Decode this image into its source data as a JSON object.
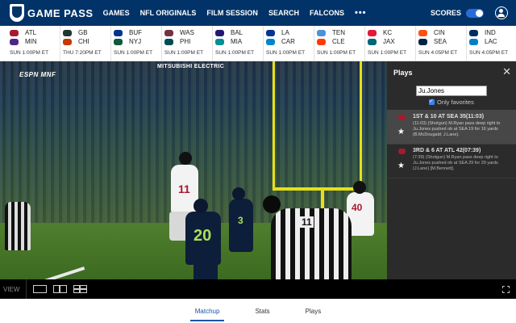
{
  "brand": "GAME PASS",
  "nav": [
    "GAMES",
    "NFL ORIGINALS",
    "FILM SESSION",
    "SEARCH",
    "FALCONS"
  ],
  "nav_more": "•••",
  "scores_label": "SCORES",
  "games": [
    {
      "away": "ATL",
      "home": "MIN",
      "away_color": "#a71930",
      "home_color": "#4f2683",
      "time": "SUN 1:00PM ET"
    },
    {
      "away": "GB",
      "home": "CHI",
      "away_color": "#203731",
      "home_color": "#c83803",
      "time": "THU 7:20PM ET"
    },
    {
      "away": "BUF",
      "home": "NYJ",
      "away_color": "#00338d",
      "home_color": "#125740",
      "time": "SUN 1:00PM ET"
    },
    {
      "away": "WAS",
      "home": "PHI",
      "away_color": "#773141",
      "home_color": "#004c54",
      "time": "SUN 1:00PM ET"
    },
    {
      "away": "BAL",
      "home": "MIA",
      "away_color": "#241773",
      "home_color": "#008e97",
      "time": "SUN 1:00PM ET"
    },
    {
      "away": "LA",
      "home": "CAR",
      "away_color": "#003594",
      "home_color": "#0085ca",
      "time": "SUN 1:00PM ET"
    },
    {
      "away": "TEN",
      "home": "CLE",
      "away_color": "#4b92db",
      "home_color": "#ff3c00",
      "time": "SUN 1:00PM ET"
    },
    {
      "away": "KC",
      "home": "JAX",
      "away_color": "#e31837",
      "home_color": "#006778",
      "time": "SUN 1:00PM ET"
    },
    {
      "away": "CIN",
      "home": "SEA",
      "away_color": "#fb4f14",
      "home_color": "#002244",
      "time": "SUN 4:05PM ET"
    },
    {
      "away": "IND",
      "home": "LAC",
      "away_color": "#002c5f",
      "home_color": "#0080c6",
      "time": "SUN 4:05PM ET"
    }
  ],
  "video": {
    "network_bug": "ESPN MNF",
    "banner": "MITSUBISHI ELECTRIC",
    "jersey_numbers": [
      "11",
      "20",
      "3",
      "40",
      "11"
    ]
  },
  "plays_panel": {
    "title": "Plays",
    "search_value": "Ju.Jones",
    "favorites_label": "Only favorites",
    "items": [
      {
        "header": "1ST & 10 AT SEA 35(11:03)",
        "description": "(11:03) (Shotgun) M.Ryan pass deep right to Ju.Jones pushed ob at SEA 19 for 16 yards (B.McDougald; J.Lane)."
      },
      {
        "header": "3RD & 6 AT ATL 42(07:39)",
        "description": "(7:39) (Shotgun) M.Ryan pass deep right to Ju.Jones pushed ob at SEA 29 for 29 yards (J.Lane) [M.Bennett]."
      }
    ]
  },
  "view_label": "VIEW",
  "tabs": [
    "Matchup",
    "Stats",
    "Plays"
  ]
}
